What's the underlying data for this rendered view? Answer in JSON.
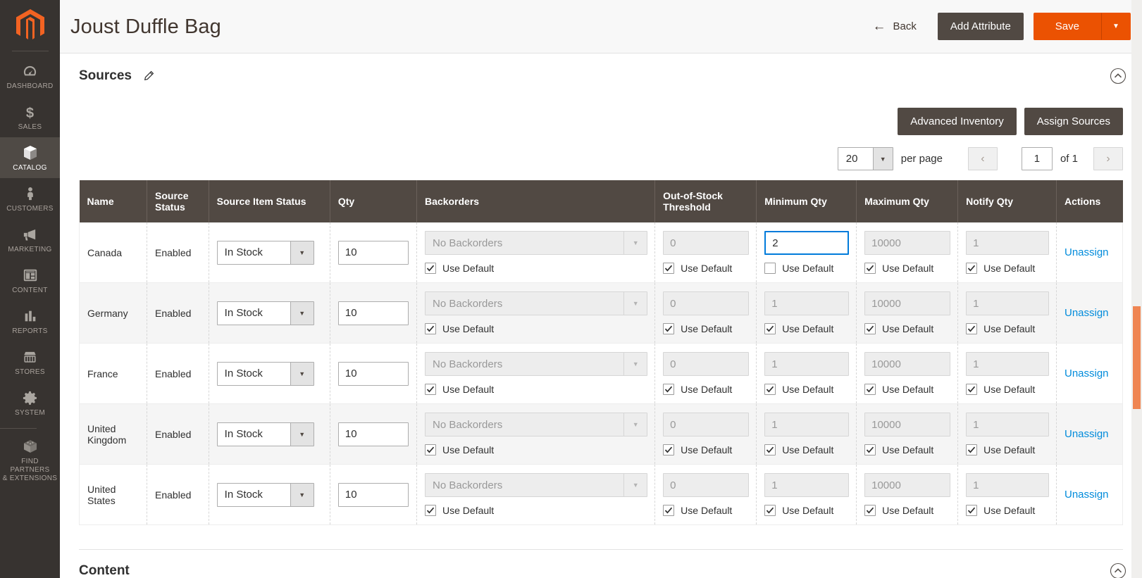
{
  "sidebar": {
    "logo_name": "magento-logo",
    "items": [
      {
        "label": "DASHBOARD",
        "icon": "dashboard-gauge-icon",
        "active": false
      },
      {
        "label": "SALES",
        "icon": "dollar-sign-icon",
        "active": false
      },
      {
        "label": "CATALOG",
        "icon": "box-icon",
        "active": true
      },
      {
        "label": "CUSTOMERS",
        "icon": "person-icon",
        "active": false
      },
      {
        "label": "MARKETING",
        "icon": "megaphone-icon",
        "active": false
      },
      {
        "label": "CONTENT",
        "icon": "layout-panels-icon",
        "active": false
      },
      {
        "label": "REPORTS",
        "icon": "bar-chart-icon",
        "active": false
      },
      {
        "label": "STORES",
        "icon": "storefront-icon",
        "active": false
      },
      {
        "label": "SYSTEM",
        "icon": "gear-icon",
        "active": false
      },
      {
        "label": "FIND PARTNERS\n& EXTENSIONS",
        "icon": "extensions-box-icon",
        "active": false
      }
    ]
  },
  "header": {
    "title": "Joust Duffle Bag",
    "back_label": "Back",
    "add_attribute_label": "Add Attribute",
    "save_label": "Save",
    "save_toggle_icon": "chevron-down-icon",
    "back_icon": "arrow-left-icon"
  },
  "section": {
    "title": "Sources",
    "edit_icon": "pencil-icon",
    "collapse_icon": "chevron-up-circle-icon"
  },
  "toolbar": {
    "advanced_inventory_label": "Advanced Inventory",
    "assign_sources_label": "Assign Sources"
  },
  "pager": {
    "per_page_value": "20",
    "per_page_label": "per page",
    "prev_icon": "chevron-left-icon",
    "next_icon": "chevron-right-icon",
    "current_page": "1",
    "of_label": "of 1"
  },
  "grid": {
    "columns": [
      "Name",
      "Source Status",
      "Source Item Status",
      "Qty",
      "Backorders",
      "Out-of-Stock Threshold",
      "Minimum Qty",
      "Maximum Qty",
      "Notify Qty",
      "Actions"
    ],
    "use_default_label": "Use Default",
    "unassign_label": "Unassign",
    "rows": [
      {
        "name": "Canada",
        "source_status": "Enabled",
        "source_item_status": "In Stock",
        "qty": "10",
        "backorders": {
          "value": "No Backorders",
          "disabled": true,
          "use_default": true
        },
        "out_of_stock_threshold": {
          "value": "0",
          "disabled": true,
          "use_default": true
        },
        "minimum_qty": {
          "value": "2",
          "disabled": false,
          "focused": true,
          "use_default": false
        },
        "maximum_qty": {
          "value": "10000",
          "disabled": true,
          "use_default": true
        },
        "notify_qty": {
          "value": "1",
          "disabled": true,
          "use_default": true
        }
      },
      {
        "name": "Germany",
        "source_status": "Enabled",
        "source_item_status": "In Stock",
        "qty": "10",
        "backorders": {
          "value": "No Backorders",
          "disabled": true,
          "use_default": true
        },
        "out_of_stock_threshold": {
          "value": "0",
          "disabled": true,
          "use_default": true
        },
        "minimum_qty": {
          "value": "1",
          "disabled": true,
          "focused": false,
          "use_default": true
        },
        "maximum_qty": {
          "value": "10000",
          "disabled": true,
          "use_default": true
        },
        "notify_qty": {
          "value": "1",
          "disabled": true,
          "use_default": true
        }
      },
      {
        "name": "France",
        "source_status": "Enabled",
        "source_item_status": "In Stock",
        "qty": "10",
        "backorders": {
          "value": "No Backorders",
          "disabled": true,
          "use_default": true
        },
        "out_of_stock_threshold": {
          "value": "0",
          "disabled": true,
          "use_default": true
        },
        "minimum_qty": {
          "value": "1",
          "disabled": true,
          "focused": false,
          "use_default": true
        },
        "maximum_qty": {
          "value": "10000",
          "disabled": true,
          "use_default": true
        },
        "notify_qty": {
          "value": "1",
          "disabled": true,
          "use_default": true
        }
      },
      {
        "name": "United Kingdom",
        "source_status": "Enabled",
        "source_item_status": "In Stock",
        "qty": "10",
        "backorders": {
          "value": "No Backorders",
          "disabled": true,
          "use_default": true
        },
        "out_of_stock_threshold": {
          "value": "0",
          "disabled": true,
          "use_default": true
        },
        "minimum_qty": {
          "value": "1",
          "disabled": true,
          "focused": false,
          "use_default": true
        },
        "maximum_qty": {
          "value": "10000",
          "disabled": true,
          "use_default": true
        },
        "notify_qty": {
          "value": "1",
          "disabled": true,
          "use_default": true
        }
      },
      {
        "name": "United States",
        "source_status": "Enabled",
        "source_item_status": "In Stock",
        "qty": "10",
        "backorders": {
          "value": "No Backorders",
          "disabled": true,
          "use_default": true
        },
        "out_of_stock_threshold": {
          "value": "0",
          "disabled": true,
          "use_default": true
        },
        "minimum_qty": {
          "value": "1",
          "disabled": true,
          "focused": false,
          "use_default": true
        },
        "maximum_qty": {
          "value": "10000",
          "disabled": true,
          "use_default": true
        },
        "notify_qty": {
          "value": "1",
          "disabled": true,
          "use_default": true
        }
      }
    ]
  },
  "next_section": {
    "title": "Content",
    "collapse_icon": "chevron-up-circle-icon"
  },
  "colors": {
    "brand_orange": "#eb5202",
    "sidebar_bg": "#373330",
    "table_header_bg": "#514943",
    "link_blue": "#008bdb",
    "focus_blue": "#007bdb",
    "scrollbar_thumb": "#ef8552"
  }
}
